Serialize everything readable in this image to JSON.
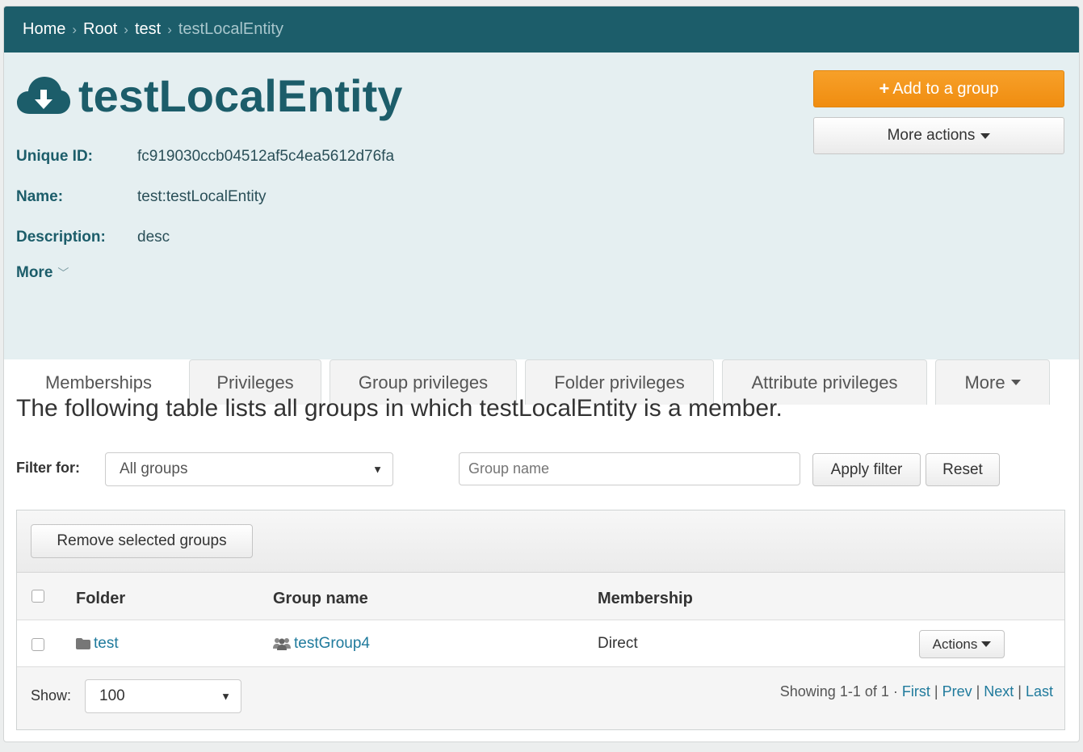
{
  "breadcrumb": {
    "items": [
      "Home",
      "Root",
      "test"
    ],
    "current": "testLocalEntity",
    "separator": "›"
  },
  "entity": {
    "title": "testLocalEntity",
    "icon": "cloud-download-icon",
    "fields": [
      {
        "label": "Unique ID:",
        "value": "fc919030ccb04512af5c4ea5612d76fa"
      },
      {
        "label": "Name:",
        "value": "test:testLocalEntity"
      },
      {
        "label": "Description:",
        "value": "desc"
      }
    ],
    "more_label": "More"
  },
  "actions": {
    "add_to_group": "Add to a group",
    "more_actions": "More actions"
  },
  "tabs": [
    {
      "label": "Memberships",
      "active": true
    },
    {
      "label": "Privileges"
    },
    {
      "label": "Group privileges"
    },
    {
      "label": "Folder privileges"
    },
    {
      "label": "Attribute privileges"
    },
    {
      "label": "More"
    }
  ],
  "memberships": {
    "lead": "The following table lists all groups in which testLocalEntity is a member.",
    "filter_label": "Filter for:",
    "filter_select": "All groups",
    "group_name_placeholder": "Group name",
    "apply_filter": "Apply filter",
    "reset": "Reset",
    "remove_selected": "Remove selected groups",
    "columns": [
      "Folder",
      "Group name",
      "Membership"
    ],
    "rows": [
      {
        "folder": "test",
        "group": "testGroup4",
        "membership": "Direct",
        "actions": "Actions"
      }
    ],
    "show_label": "Show:",
    "show_value": "100",
    "paging": {
      "summary": "Showing 1-1 of 1 ·",
      "first": "First",
      "prev": "Prev",
      "next": "Next",
      "last": "Last"
    }
  },
  "colors": {
    "brand": "#1c5d6a",
    "accent": "#f08d10",
    "link": "#1f7a9c"
  }
}
